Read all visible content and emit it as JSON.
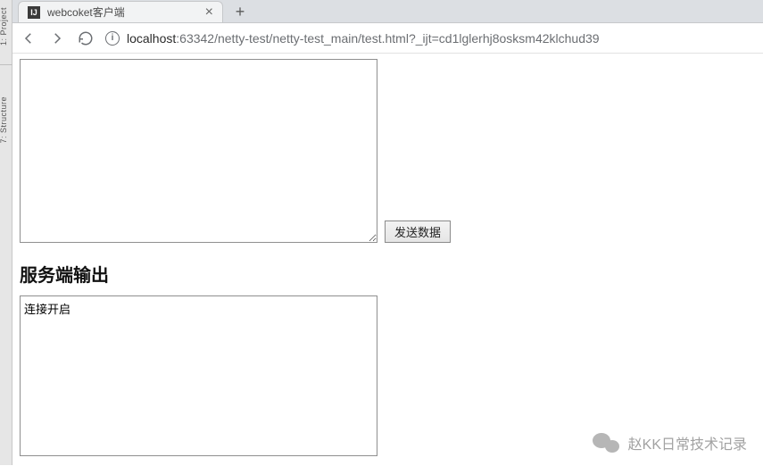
{
  "ide": {
    "tabs": [
      "1: Project",
      "7: Structure"
    ]
  },
  "browser": {
    "tab": {
      "favicon_text": "IJ",
      "title": "webcoket客户端"
    },
    "url": {
      "host": "localhost",
      "port_and_path": ":63342/netty-test/netty-test_main/test.html?_ijt=cd1lglerhj8osksm42klchud39"
    }
  },
  "page": {
    "input_value": "",
    "send_button_label": "发送数据",
    "output_heading": "服务端输出",
    "output_value": "连接开启"
  },
  "watermark": {
    "text": "赵KK日常技术记录"
  }
}
